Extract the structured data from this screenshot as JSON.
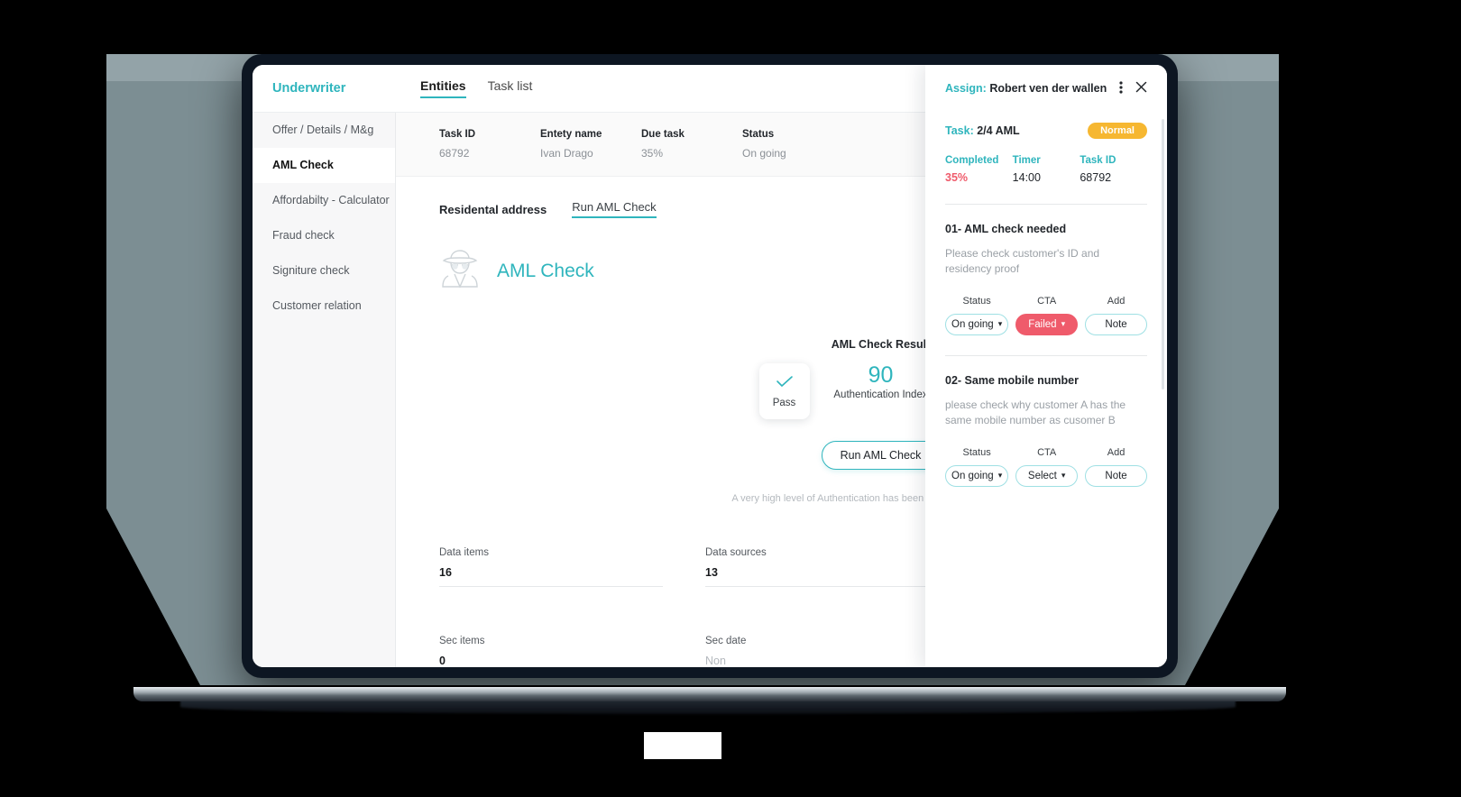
{
  "app": {
    "brand": "Underwriter",
    "tabs": [
      {
        "label": "Entities",
        "active": true
      },
      {
        "label": "Task list",
        "active": false
      }
    ]
  },
  "sidebar": {
    "items": [
      {
        "label": "Offer / Details / M&g",
        "active": false
      },
      {
        "label": "AML Check",
        "active": true
      },
      {
        "label": "Affordabilty - Calculator",
        "active": false
      },
      {
        "label": "Fraud check",
        "active": false
      },
      {
        "label": "Signiture check",
        "active": false
      },
      {
        "label": "Customer relation",
        "active": false
      }
    ]
  },
  "meta": [
    {
      "key": "Task ID",
      "value": "68792"
    },
    {
      "key": "Entety name",
      "value": "Ivan Drago"
    },
    {
      "key": "Due task",
      "value": "35%"
    },
    {
      "key": "Status",
      "value": "On going"
    }
  ],
  "section_tabs": {
    "residential": "Residental address",
    "run_link": "Run AML Check"
  },
  "aml": {
    "icon": "detective-icon",
    "title": "AML Check",
    "result_title": "AML Check Result",
    "pass_label": "Pass",
    "failed_label": "Failed",
    "index_value": "90",
    "index_caption": "Authentication Index",
    "run_button": "Run AML Check",
    "note": "A very high level of Authentication has been found for the identity su"
  },
  "stats": [
    {
      "key": "Data items",
      "value": "16",
      "muted": false
    },
    {
      "key": "Data sources",
      "value": "13",
      "muted": false
    },
    {
      "key": "Sec items",
      "value": "0",
      "muted": false
    },
    {
      "key": "Sec date",
      "value": "Non",
      "muted": true
    }
  ],
  "panel": {
    "assign_label": "Assign:",
    "assign_value": "Robert ven der wallen",
    "kebab_icon": "kebab-menu-icon",
    "close_icon": "close-icon",
    "task_label": "Task:",
    "task_value": "2/4 AML",
    "priority_badge": "Normal",
    "kpis": [
      {
        "key": "Completed",
        "value": "35%",
        "accent": "red"
      },
      {
        "key": "Timer",
        "value": "14:00",
        "accent": "none"
      },
      {
        "key": "Task ID",
        "value": "68792",
        "accent": "none"
      }
    ],
    "items": [
      {
        "title": "01- AML check needed",
        "desc": "Please check customer's ID and residency proof",
        "status_label": "Status",
        "status_value": "On going",
        "cta_label": "CTA",
        "cta_value": "Failed",
        "cta_danger": true,
        "add_label": "Add",
        "add_value": "Note"
      },
      {
        "title": "02- Same mobile number",
        "desc": "please check why customer A has the same mobile number as cusomer B",
        "status_label": "Status",
        "status_value": "On going",
        "cta_label": "CTA",
        "cta_value": "Select",
        "cta_danger": false,
        "add_label": "Add",
        "add_value": "Note"
      }
    ]
  },
  "colors": {
    "accent": "#2fb5bd",
    "danger": "#ef5b6b",
    "warning": "#f6b731",
    "text": "#22262b"
  }
}
